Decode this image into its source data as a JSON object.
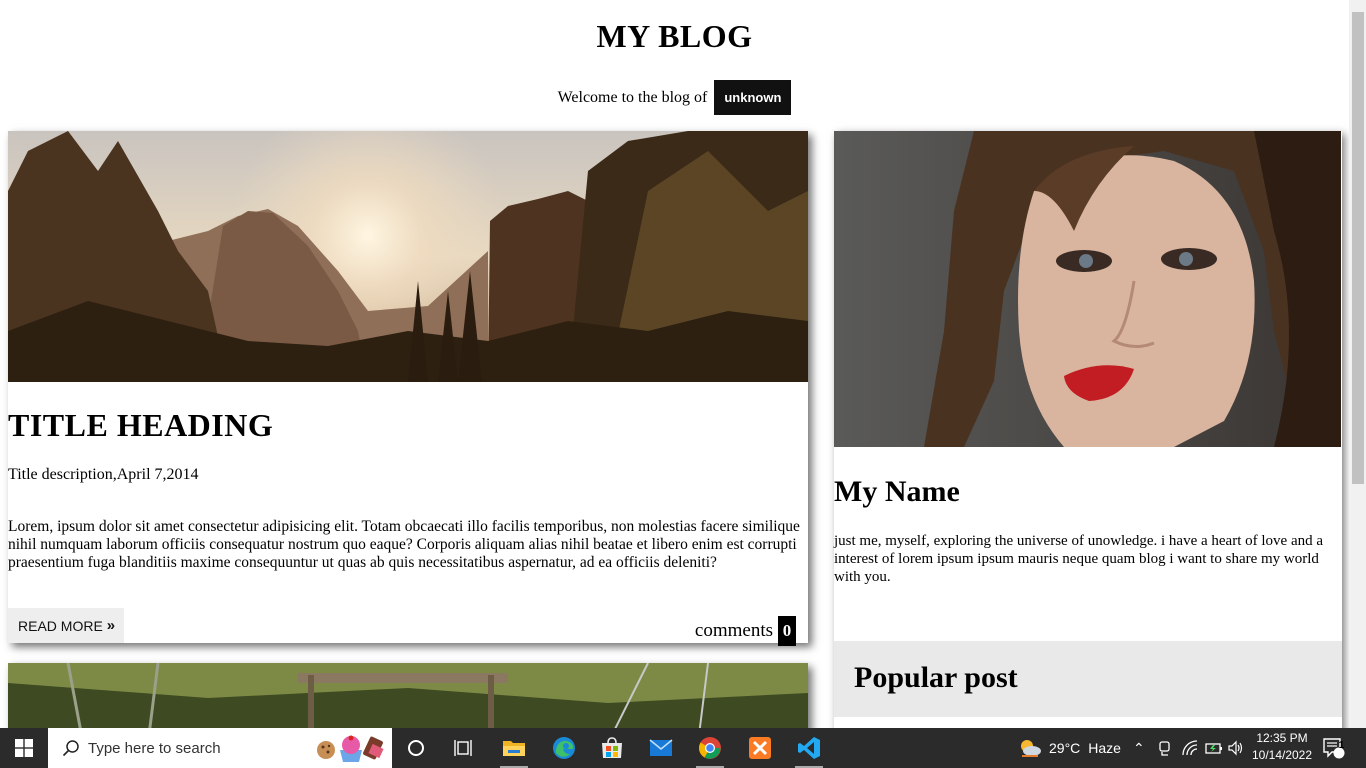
{
  "header": {
    "title": "MY BLOG",
    "welcome_text": "Welcome to the blog of",
    "owner_badge": "unknown"
  },
  "post": {
    "image_alt": "sunset-mountain-forest-photo",
    "title": "TITLE HEADING",
    "subtitle": "Title description,April 7,2014",
    "body": "Lorem, ipsum dolor sit amet consectetur adipisicing elit. Totam obcaecati illo facilis temporibus, non molestias facere similique nihil numquam laborum officiis consequatur nostrum quo eaque? Corporis aliquam alias nihil beatae et libero enim est corrupti praesentium fuga blanditiis maxime consequuntur ut quas ab quis necessitatibus aspernatur, ad ea officiis deleniti?",
    "read_more_label": "READ MORE",
    "read_more_icon": "double-chevron-right-icon",
    "comments_label": "comments",
    "comments_count": "0"
  },
  "second_post": {
    "image_alt": "forest-swing-photo"
  },
  "sidebar": {
    "image_alt": "portrait-photo",
    "name": "My Name",
    "bio": "just me, myself, exploring the universe of unowledge. i have a heart of love and a interest of lorem ipsum ipsum mauris neque quam blog i want to share my world with you.",
    "popular_heading": "Popular post"
  },
  "taskbar": {
    "search_placeholder": "Type here to search",
    "weather_temp": "29°C",
    "weather_desc": "Haze",
    "time": "12:35 PM",
    "date": "10/14/2022",
    "notification_count": "1",
    "pinned_apps": [
      "cortana",
      "task-view",
      "file-explorer",
      "edge",
      "microsoft-store",
      "mail",
      "chrome",
      "xampp",
      "vscode"
    ]
  },
  "colors": {
    "badge_bg": "#111111",
    "taskbar_bg": "#2b2b2b",
    "popular_bg": "#e9e9e9"
  }
}
